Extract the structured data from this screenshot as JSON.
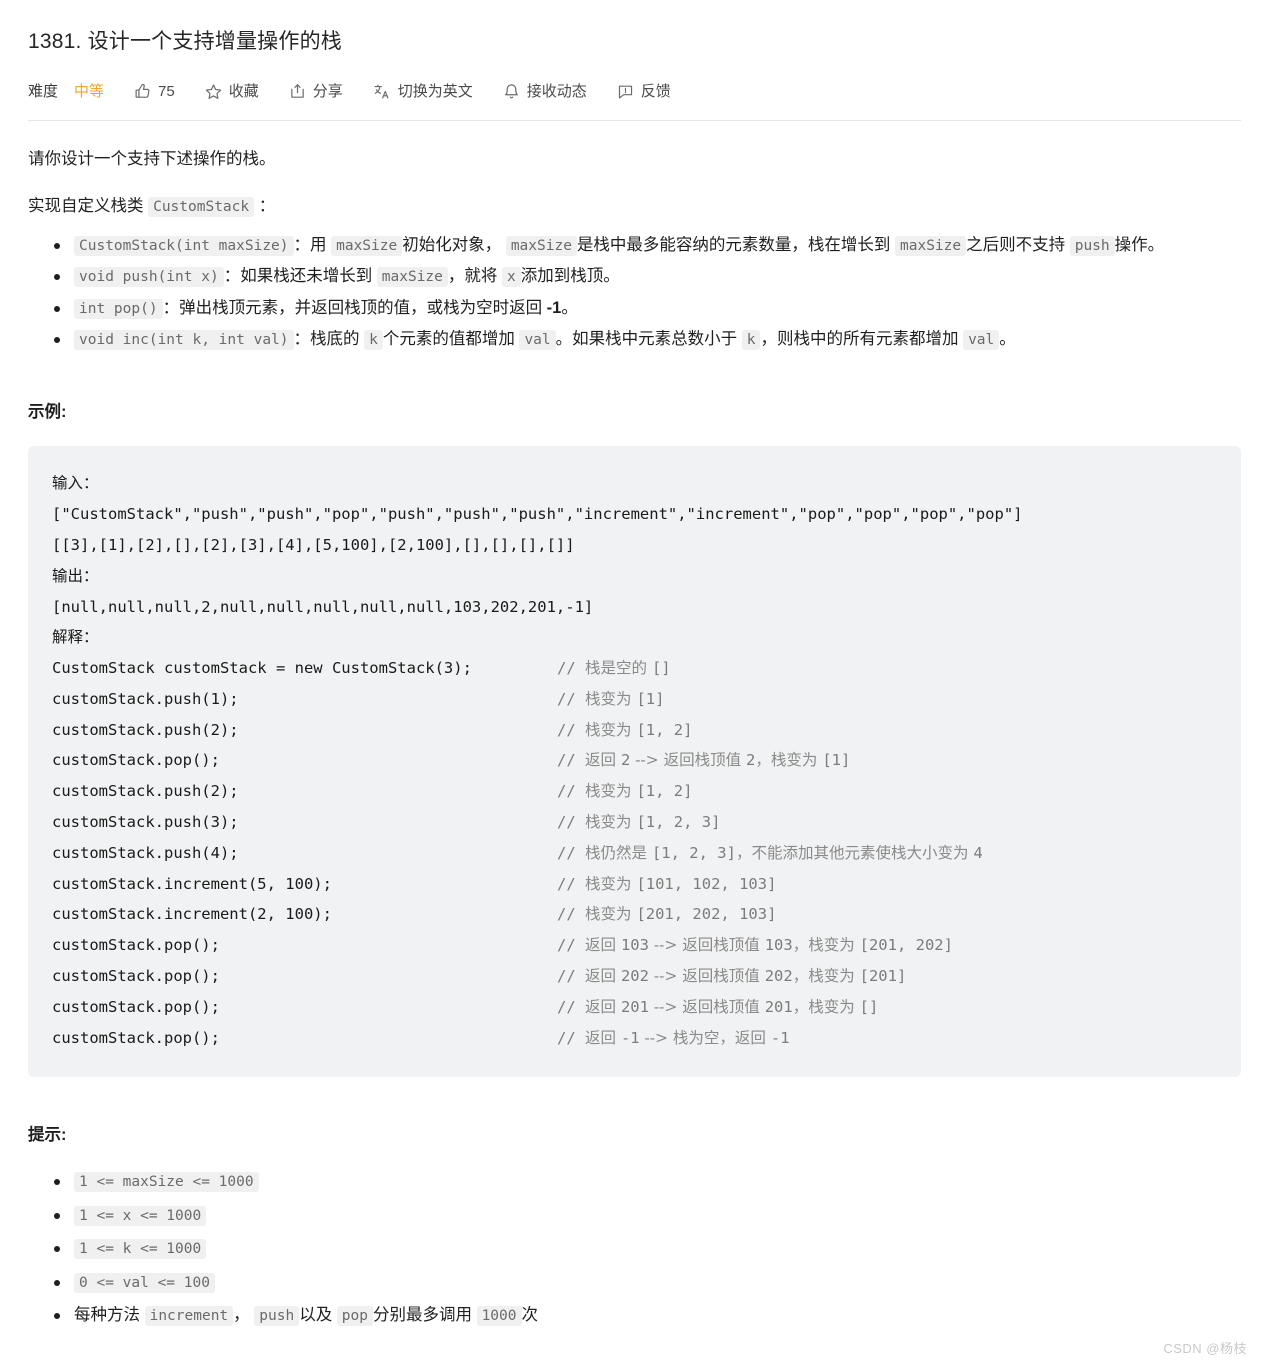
{
  "header": {
    "title": "1381. 设计一个支持增量操作的栈",
    "difficulty_label": "难度",
    "difficulty_value": "中等",
    "difficulty_color": "#f0a52b",
    "like_count": "75",
    "favorite_label": "收藏",
    "share_label": "分享",
    "translate_label": "切换为英文",
    "subscribe_label": "接收动态",
    "feedback_label": "反馈",
    "icons": {
      "like": "thumbs-up-icon",
      "favorite": "star-icon",
      "share": "share-icon",
      "translate": "translate-icon",
      "subscribe": "bell-icon",
      "feedback": "feedback-icon"
    }
  },
  "body": {
    "intro": "请你设计一个支持下述操作的栈。",
    "impl_prefix": "实现自定义栈类",
    "impl_code": "CustomStack",
    "impl_suffix": "：",
    "spec_items": [
      {
        "code": "CustomStack(int maxSize)",
        "t1": "：用",
        "c1": "maxSize",
        "t2": "初始化对象，",
        "c2": "maxSize",
        "t3": "是栈中最多能容纳的元素数量，栈在增长到",
        "c3": "maxSize",
        "t4": "之后则不支持",
        "c4": "push",
        "t5": "操作。"
      },
      {
        "code": "void push(int x)",
        "t1": "：如果栈还未增长到",
        "c1": "maxSize",
        "t2": "，就将",
        "c2": "x",
        "t3": "添加到栈顶。"
      },
      {
        "code": "int pop()",
        "t1": "：弹出栈顶元素，并返回栈顶的值，或栈为空时返回",
        "b1": "-1",
        "t2": "。"
      },
      {
        "code": "void inc(int k, int val)",
        "t1": "：栈底的",
        "c1": "k",
        "t2": "个元素的值都增加",
        "c2": "val",
        "t3": "。如果栈中元素总数小于",
        "c3": "k",
        "t4": "，则栈中的所有元素都增加",
        "c4": "val",
        "t5": "。"
      }
    ],
    "example_heading": "示例:",
    "example": {
      "input_label": "输入：",
      "input_line1": "[\"CustomStack\",\"push\",\"push\",\"pop\",\"push\",\"push\",\"push\",\"increment\",\"increment\",\"pop\",\"pop\",\"pop\",\"pop\"]",
      "input_line2": "[[3],[1],[2],[],[2],[3],[4],[5,100],[2,100],[],[],[],[]]",
      "output_label": "输出：",
      "output_line": "[null,null,null,2,null,null,null,null,null,103,202,201,-1]",
      "explain_label": "解释：",
      "code_lines": [
        {
          "stmt": "CustomStack customStack = new CustomStack(3);",
          "comment_mark": "// ",
          "comment_cn": "栈是空的 ",
          "comment_code": "[]"
        },
        {
          "stmt": "customStack.push(1);",
          "comment_mark": "// ",
          "comment_cn": "栈变为 ",
          "comment_code": "[1]"
        },
        {
          "stmt": "customStack.push(2);",
          "comment_mark": "// ",
          "comment_cn": "栈变为 ",
          "comment_code": "[1, 2]"
        },
        {
          "stmt": "customStack.pop();",
          "comment_mark": "// ",
          "comment_cn": "返回 ",
          "comment_code": "2",
          "comment_cn2": " --> 返回栈顶值 ",
          "comment_code2": "2",
          "comment_cn3": "，栈变为 ",
          "comment_code3": "[1]"
        },
        {
          "stmt": "customStack.push(2);",
          "comment_mark": "// ",
          "comment_cn": "栈变为 ",
          "comment_code": "[1, 2]"
        },
        {
          "stmt": "customStack.push(3);",
          "comment_mark": "// ",
          "comment_cn": "栈变为 ",
          "comment_code": "[1, 2, 3]"
        },
        {
          "stmt": "customStack.push(4);",
          "comment_mark": "// ",
          "comment_cn": "栈仍然是 ",
          "comment_code": "[1, 2, 3]",
          "comment_cn2": "，不能添加其他元素使栈大小变为 ",
          "comment_code2": "4"
        },
        {
          "stmt": "customStack.increment(5, 100);",
          "comment_mark": "// ",
          "comment_cn": "栈变为 ",
          "comment_code": "[101, 102, 103]"
        },
        {
          "stmt": "customStack.increment(2, 100);",
          "comment_mark": "// ",
          "comment_cn": "栈变为 ",
          "comment_code": "[201, 202, 103]"
        },
        {
          "stmt": "customStack.pop();",
          "comment_mark": "// ",
          "comment_cn": "返回 ",
          "comment_code": "103",
          "comment_cn2": " --> 返回栈顶值 ",
          "comment_code2": "103",
          "comment_cn3": "，栈变为 ",
          "comment_code3": "[201, 202]"
        },
        {
          "stmt": "customStack.pop();",
          "comment_mark": "// ",
          "comment_cn": "返回 ",
          "comment_code": "202",
          "comment_cn2": " --> 返回栈顶值 ",
          "comment_code2": "202",
          "comment_cn3": "，栈变为 ",
          "comment_code3": "[201]"
        },
        {
          "stmt": "customStack.pop();",
          "comment_mark": "// ",
          "comment_cn": "返回 ",
          "comment_code": "201",
          "comment_cn2": " --> 返回栈顶值 ",
          "comment_code2": "201",
          "comment_cn3": "，栈变为 ",
          "comment_code3": "[]"
        },
        {
          "stmt": "customStack.pop();",
          "comment_mark": "// ",
          "comment_cn": "返回 ",
          "comment_code": "-1",
          "comment_cn2": " --> 栈为空，返回 ",
          "comment_code2": "-1"
        }
      ]
    },
    "hints_heading": "提示:",
    "hints": [
      {
        "code": "1 <= maxSize <= 1000"
      },
      {
        "code": "1 <= x <= 1000"
      },
      {
        "code": "1 <= k <= 1000"
      },
      {
        "code": "0 <= val <= 100"
      },
      {
        "t0": "每种方法",
        "c1": "increment",
        "t1": "，",
        "c2": "push",
        "t2": "以及",
        "c3": "pop",
        "t3": "分别最多调用",
        "c4": "1000",
        "t4": "次"
      }
    ]
  },
  "watermark": "CSDN @杨枝"
}
